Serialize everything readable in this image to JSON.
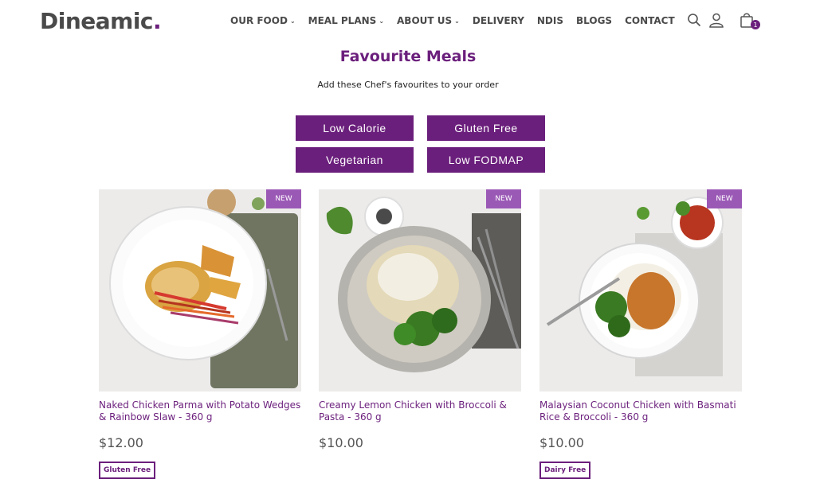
{
  "header": {
    "logo_text": "Dineamic",
    "logo_dot": ".",
    "nav": [
      {
        "label": "OUR FOOD",
        "has_dropdown": true
      },
      {
        "label": "MEAL PLANS",
        "has_dropdown": true
      },
      {
        "label": "ABOUT US",
        "has_dropdown": true
      },
      {
        "label": "DELIVERY",
        "has_dropdown": false
      },
      {
        "label": "NDIS",
        "has_dropdown": false
      },
      {
        "label": "BLOGS",
        "has_dropdown": false
      },
      {
        "label": "CONTACT",
        "has_dropdown": false
      }
    ],
    "icons": [
      "search-icon",
      "user-icon",
      "cart-icon"
    ],
    "cart_count": "1"
  },
  "section": {
    "title": "Favourite Meals",
    "subtitle": "Add these Chef's favourites to your order"
  },
  "filters": [
    "Low Calorie",
    "Gluten Free",
    "Vegetarian",
    "Low FODMAP"
  ],
  "products": [
    {
      "badge": "NEW",
      "name": "Naked Chicken Parma with Potato Wedges & Rainbow Slaw - 360 g",
      "price": "$12.00",
      "tag": "Gluten Free"
    },
    {
      "badge": "NEW",
      "name": "Creamy Lemon Chicken with Broccoli & Pasta - 360 g",
      "price": "$10.00",
      "tag": ""
    },
    {
      "badge": "NEW",
      "name": "Malaysian Coconut Chicken with Basmati Rice & Broccoli - 360 g",
      "price": "$10.00",
      "tag": "Dairy Free"
    }
  ],
  "colors": {
    "brand": "#6b1f7c",
    "badge": "#9b59b6"
  }
}
